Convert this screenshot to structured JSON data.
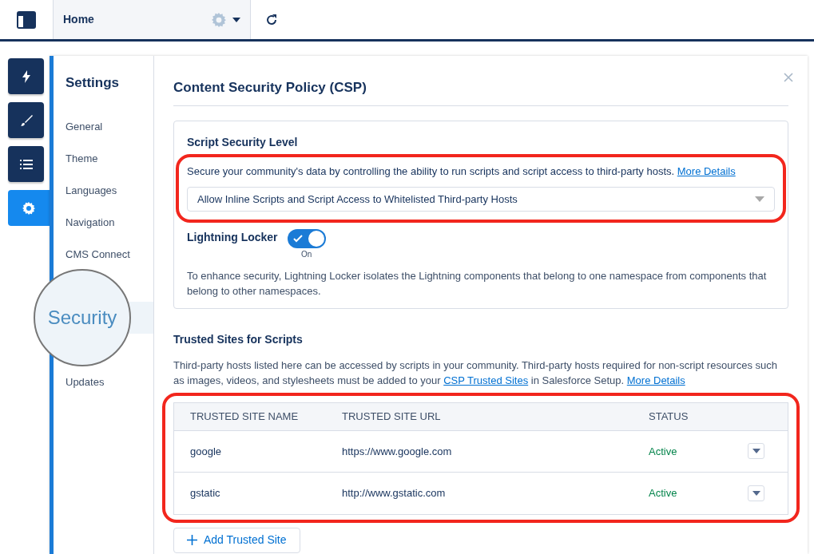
{
  "topbar": {
    "page": "Home"
  },
  "rail_tabs": [
    {
      "kind": "bolt",
      "selected": false
    },
    {
      "kind": "brush",
      "selected": false
    },
    {
      "kind": "list",
      "selected": false
    },
    {
      "kind": "gear",
      "selected": true
    }
  ],
  "settings_nav": {
    "title": "Settings",
    "items": [
      {
        "label": "General",
        "selected": false
      },
      {
        "label": "Theme",
        "selected": false
      },
      {
        "label": "Languages",
        "selected": false
      },
      {
        "label": "Navigation",
        "selected": false
      },
      {
        "label": "CMS Connect",
        "selected": false
      },
      {
        "label": "Security",
        "selected": true
      },
      {
        "label": "Updates",
        "selected": false
      }
    ]
  },
  "panel": {
    "title": "Content Security Policy (CSP)",
    "script_security": {
      "heading": "Script Security Level",
      "description": "Secure your community's data by controlling the ability to run scripts and script access to third-party hosts.",
      "link": "More Details",
      "select_value": "Allow Inline Scripts and Script Access to Whitelisted Third-party Hosts"
    },
    "locker": {
      "label": "Lightning Locker",
      "on": true,
      "state_label": "On",
      "description": "To enhance security, Lightning Locker isolates the Lightning components that belong to one namespace from components that belong to other namespaces."
    },
    "trusted": {
      "heading": "Trusted Sites for Scripts",
      "segments": [
        {
          "kind": "text",
          "text": "Third-party hosts listed here can be accessed by scripts in your community. Third-party hosts required for non-script resources such as images, videos, and stylesheets must be added to your "
        },
        {
          "kind": "link",
          "text": "CSP Trusted Sites"
        },
        {
          "kind": "text",
          "text": " in Salesforce Setup. "
        },
        {
          "kind": "link",
          "text": "More Details"
        }
      ],
      "columns": [
        "TRUSTED SITE NAME",
        "TRUSTED SITE URL",
        "STATUS"
      ],
      "rows": [
        {
          "name": "google",
          "url": "https://www.google.com",
          "status": "Active"
        },
        {
          "name": "gstatic",
          "url": "http://www.gstatic.com",
          "status": "Active"
        }
      ],
      "add_button": "Add Trusted Site"
    }
  }
}
